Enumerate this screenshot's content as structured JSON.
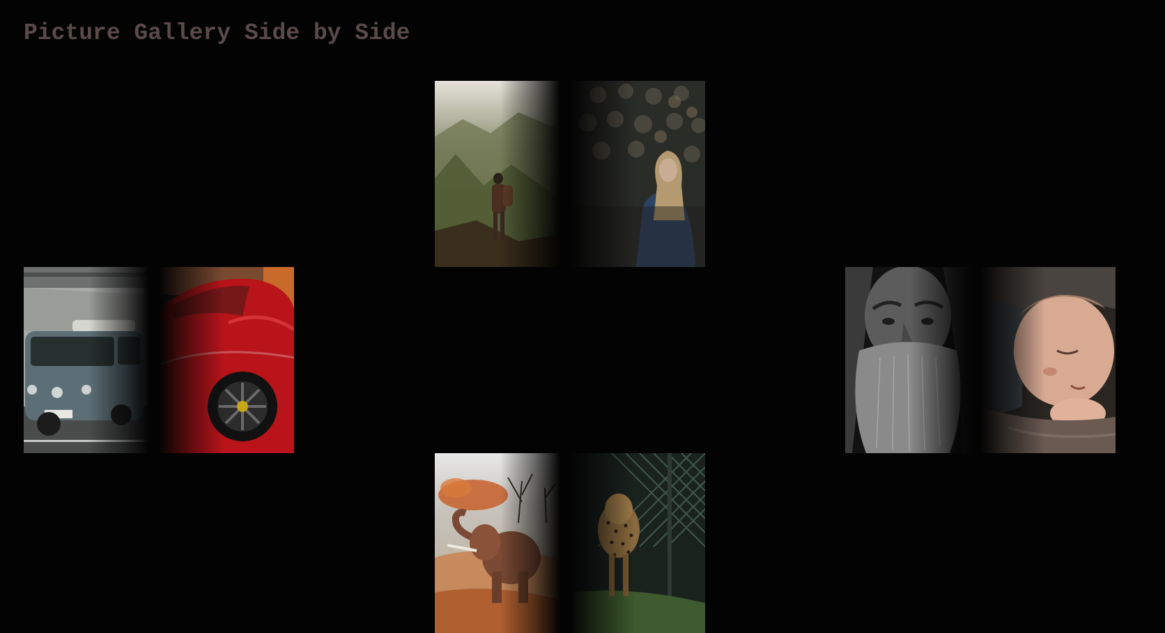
{
  "page": {
    "title": "Picture Gallery Side by Side",
    "title_color": "#5b4a4a",
    "background": "#030303"
  },
  "gallery": {
    "pairs": [
      {
        "position": "top",
        "images": [
          {
            "subject": "hiker-on-mountain-icon",
            "palette": [
              "#d8d2c4",
              "#7a8258",
              "#3a3a22"
            ]
          },
          {
            "subject": "woman-in-crowd-icon",
            "palette": [
              "#565a4e",
              "#2e3a52",
              "#1c1f1c"
            ]
          }
        ]
      },
      {
        "position": "left",
        "images": [
          {
            "subject": "vw-camper-van-icon",
            "palette": [
              "#b8bab6",
              "#5b6f76",
              "#2a2c2d"
            ]
          },
          {
            "subject": "red-sports-car-icon",
            "palette": [
              "#c01818",
              "#5a0a0a",
              "#1a1a1a"
            ]
          }
        ]
      },
      {
        "position": "right",
        "images": [
          {
            "subject": "bearded-old-man-icon",
            "palette": [
              "#9c9c9c",
              "#4a4a4a",
              "#141414"
            ]
          },
          {
            "subject": "sleeping-baby-icon",
            "palette": [
              "#c8a08c",
              "#6a5048",
              "#2a2420"
            ]
          }
        ]
      },
      {
        "position": "bottom",
        "images": [
          {
            "subject": "elephant-dust-icon",
            "palette": [
              "#dcdcdc",
              "#c06a30",
              "#4a2a18"
            ]
          },
          {
            "subject": "cheetah-by-fence-icon",
            "palette": [
              "#2a3a34",
              "#6a5636",
              "#111511"
            ]
          }
        ]
      }
    ]
  }
}
